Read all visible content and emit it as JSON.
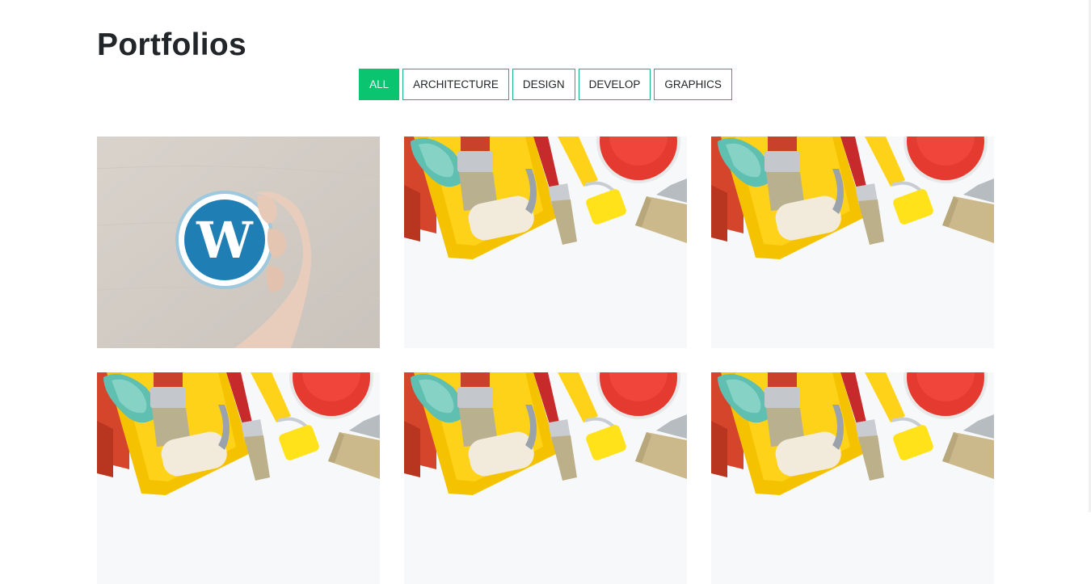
{
  "page": {
    "title": "Portfolios"
  },
  "filters": [
    {
      "label": "ALL",
      "active": true
    },
    {
      "label": "ARCHITECTURE",
      "active": false
    },
    {
      "label": "DESIGN",
      "active": false
    },
    {
      "label": "DEVELOP",
      "active": false
    },
    {
      "label": "GRAPHICS",
      "active": false
    }
  ],
  "portfolio_items": [
    {
      "image": "wordpress-logo-in-hand"
    },
    {
      "image": "paint-tools-flatlay"
    },
    {
      "image": "paint-tools-flatlay"
    },
    {
      "image": "paint-tools-flatlay"
    },
    {
      "image": "paint-tools-flatlay"
    },
    {
      "image": "paint-tools-flatlay"
    }
  ],
  "colors": {
    "accent": "#0bc46f",
    "filter_border": "#19b388",
    "heading": "#222629"
  }
}
